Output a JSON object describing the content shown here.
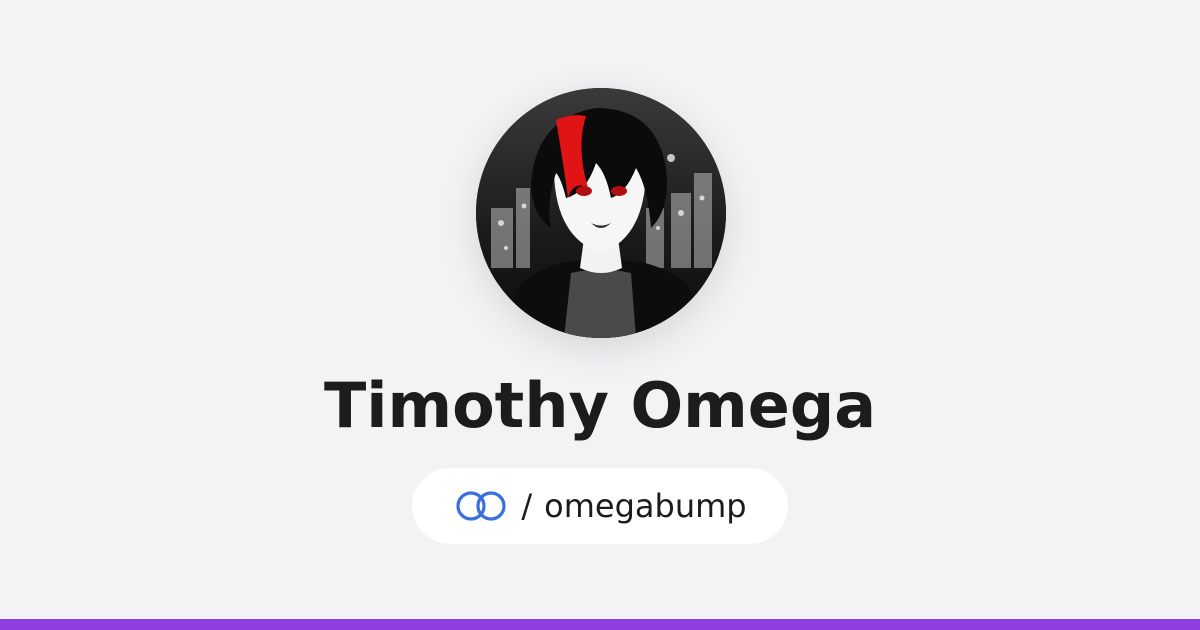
{
  "profile": {
    "name": "Timothy Omega",
    "handle_separator": "/",
    "handle": "omegabump",
    "avatar_icon": "anime-character-avatar"
  },
  "brand": {
    "icon": "linked-rings-icon",
    "icon_color": "#3a6fe0"
  },
  "colors": {
    "background": "#f3f3f6",
    "accent_bar": "#8e3ee0",
    "text": "#1c1c1e"
  }
}
